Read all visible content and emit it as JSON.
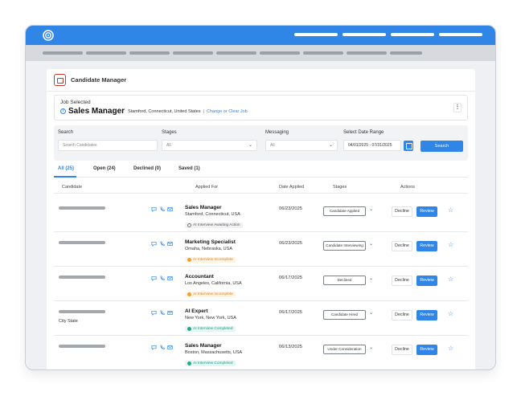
{
  "panel": {
    "title": "Candidate Manager"
  },
  "job": {
    "label": "Job Selected",
    "title": "Sales Manager",
    "location": "Stamford, Connecticut, United States",
    "separator": "|",
    "change_link": "Change or Clear Job"
  },
  "filters": {
    "search_label": "Search",
    "search_placeholder": "Search Candidates",
    "stages_label": "Stages",
    "stages_value": "All",
    "messaging_label": "Messaging",
    "messaging_value": "All",
    "date_label": "Select Date Range",
    "date_value": "04/01/2025 - 07/31/2025",
    "search_button": "Search"
  },
  "tabs": [
    {
      "label": "All (25)",
      "active": true
    },
    {
      "label": "Open (24)",
      "active": false
    },
    {
      "label": "Declined (0)",
      "active": false
    },
    {
      "label": "Saved (1)",
      "active": false
    }
  ],
  "columns": [
    "Candidate",
    "Applied For",
    "Date Applied",
    "Stages",
    "Actions"
  ],
  "rows": [
    {
      "sub": "",
      "title": "Sales Manager",
      "location": "Stamford, Connecticut, USA",
      "badge": "AI Interview Awaiting Action",
      "badge_type": "gray",
      "date": "06/23/2025",
      "stage": "Candidate Applied"
    },
    {
      "sub": "",
      "title": "Marketing Specialist",
      "location": "Omaha, Nebraska, USA",
      "badge": "AI Interview Incomplete",
      "badge_type": "orange",
      "date": "06/23/2025",
      "stage": "Candidate Interviewing"
    },
    {
      "sub": "",
      "title": "Accountant",
      "location": "Los Angeles, California, USA",
      "badge": "AI Interview Incomplete",
      "badge_type": "orange",
      "date": "06/17/2025",
      "stage": "Declined"
    },
    {
      "sub": "City State",
      "title": "AI Expert",
      "location": "New York, New York, USA",
      "badge": "AI Interview Completed",
      "badge_type": "teal",
      "date": "06/17/2025",
      "stage": "Candidate Hired"
    },
    {
      "sub": "",
      "title": "Sales Manager",
      "location": "Boston, Massachusetts, USA",
      "badge": "AI Interview Completed",
      "badge_type": "teal",
      "date": "06/13/2025",
      "stage": "Under Consideration"
    }
  ],
  "actions": {
    "decline": "Decline",
    "review": "Review"
  },
  "icons": {
    "logo": "spiral-logo-icon",
    "chat": "chat-icon",
    "phone": "phone-icon",
    "mail": "mail-icon",
    "star": "star-icon",
    "calendar": "calendar-icon",
    "info": "info-icon",
    "kebab": "kebab-menu-icon"
  },
  "colors": {
    "accent": "#2f86e6",
    "orange": "#f0a030",
    "teal": "#22a88f",
    "header": "#2f86e6"
  }
}
